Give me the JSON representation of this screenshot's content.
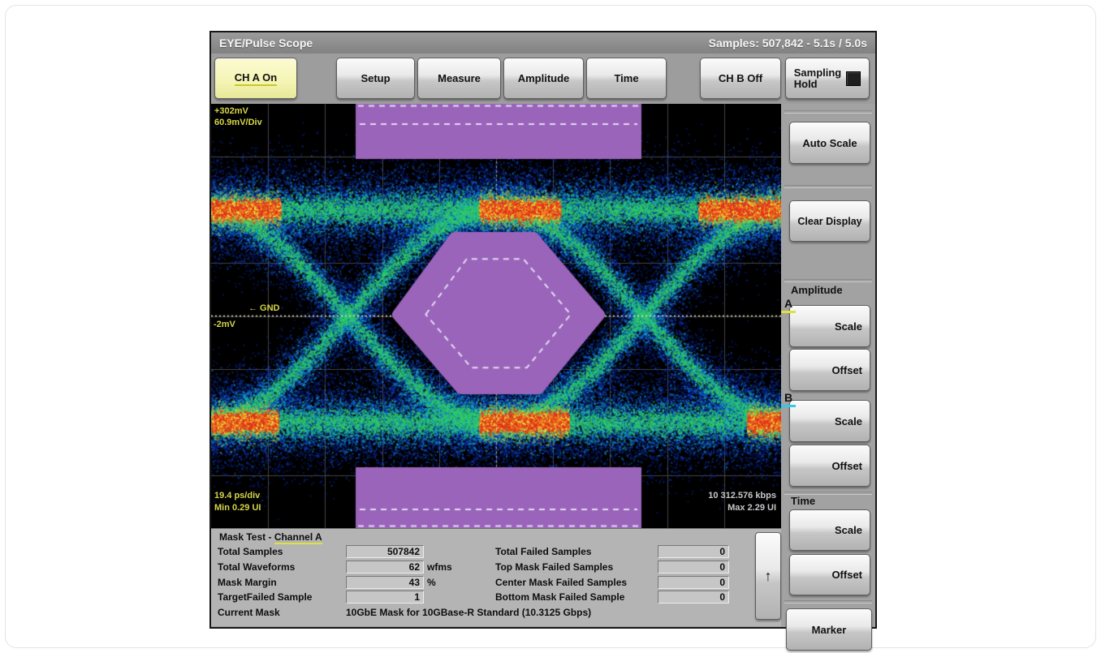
{
  "window": {
    "title": "EYE/Pulse Scope",
    "samples_readout": "Samples: 507,842 - 5.1s / 5.0s"
  },
  "toolbar": {
    "ch_a": "CH A On",
    "setup": "Setup",
    "measure": "Measure",
    "amplitude": "Amplitude",
    "time": "Time",
    "ch_b": "CH B Off",
    "sampling_line1": "Sampling",
    "sampling_line2": "Hold"
  },
  "display": {
    "top_left_line1": "+302mV",
    "top_left_line2": "60.9mV/Div",
    "gnd_label": "← GND",
    "offset_label": "-2mV",
    "bottom_left_line1": "19.4 ps/div",
    "bottom_left_line2": "Min 0.29 UI",
    "bottom_right_line1": "10 312.576 kbps",
    "bottom_right_line2": "Max 2.29 UI"
  },
  "sidebar": {
    "auto_scale": "Auto Scale",
    "clear_display": "Clear Display",
    "amplitude_section": "Amplitude",
    "time_section": "Time",
    "a_label": "A",
    "b_label": "B",
    "a_scale": "Scale",
    "a_offset": "Offset",
    "b_scale": "Scale",
    "b_offset": "Offset",
    "t_scale": "Scale",
    "t_offset": "Offset",
    "marker": "Marker"
  },
  "mask_test": {
    "header_prefix": "Mask Test - ",
    "header_channel": "Channel A",
    "rows_left": [
      {
        "label": "Total Samples",
        "value": "507842",
        "unit": ""
      },
      {
        "label": "Total Waveforms",
        "value": "62",
        "unit": "wfms"
      },
      {
        "label": "Mask Margin",
        "value": "43",
        "unit": "%"
      },
      {
        "label": "TargetFailed Sample",
        "value": "1",
        "unit": ""
      }
    ],
    "rows_right": [
      {
        "label": "Total Failed Samples",
        "value": "0"
      },
      {
        "label": "Top Mask Failed Samples",
        "value": "0"
      },
      {
        "label": "Center Mask Failed Samples",
        "value": "0"
      },
      {
        "label": "Bottom Mask Failed Sample",
        "value": "0"
      }
    ],
    "current_mask_label": "Current Mask",
    "current_mask_value": "10GbE Mask for 10GBase-R Standard  (10.3125 Gbps)",
    "scroll_up_icon": "↑"
  },
  "colors": {
    "mask_purple": "#9a64ba",
    "mask_dash": "#e4dbf2",
    "grid": "#464646",
    "gnd_dotted": "#e8e4b8",
    "label_yellow": "#d6d648",
    "channel_a_accent": "#e0e040",
    "channel_b_accent": "#35c8e8",
    "active_button": "#f4f4b4"
  },
  "chart_data": {
    "type": "heatmap",
    "title": "Eye diagram density plot with 10GbE mask test, Channel A",
    "x_axis": {
      "scale": "19.4 ps/div",
      "min_ui": 0.29,
      "max_ui": 2.29,
      "divisions": 10
    },
    "y_axis": {
      "scale": "60.9mV/Div",
      "top_value": "+302mV",
      "gnd_offset": "-2mV",
      "divisions": 8
    },
    "bit_rate": "10 312.576 kbps",
    "mask_margin_pct": 43,
    "grid": [
      10,
      8
    ],
    "eye": {
      "gnd": 0.499,
      "rail_top": 0.2486,
      "rail_bottom": 0.7495,
      "crossings": [
        0.2393,
        0.7578,
        -0.2792,
        1.2764
      ],
      "half_span": 0.2593,
      "layers": [
        {
          "sigma": 34,
          "color": "rgba(10,35,150,0.55)",
          "n_rail": 9000,
          "n_trans": 3800,
          "size": 2
        },
        {
          "sigma": 22,
          "color": "rgba(18,90,215,0.50)",
          "n_rail": 8000,
          "n_trans": 3400,
          "size": 2
        },
        {
          "sigma": 14,
          "color": "rgba(22,168,205,0.55)",
          "n_rail": 7000,
          "n_trans": 3000,
          "size": 2
        },
        {
          "sigma": 8.5,
          "color": "rgba(50,205,100,0.60)",
          "n_rail": 6000,
          "n_trans": 2600,
          "size": 2
        }
      ],
      "hotspots": {
        "top": [
          [
            0.0,
            0.121
          ],
          [
            0.47,
            0.612
          ],
          [
            0.855,
            1.0
          ]
        ],
        "bottom": [
          [
            0.0,
            0.117
          ],
          [
            0.47,
            0.627
          ],
          [
            0.94,
            1.0
          ]
        ]
      },
      "hot_colors": [
        "#e0331c",
        "#ef7c1d",
        "#ead83a"
      ],
      "halo_color": "rgba(167,207,58,0.5)"
    },
    "masks": {
      "color": "#9a64ba",
      "top_rect": {
        "x0": 0.2536,
        "x1": 0.755,
        "y0": 0.0,
        "y1": 0.13,
        "margin_y": 0.0478
      },
      "bottom_rect": {
        "x0": 0.2536,
        "x1": 0.755,
        "y0": 0.8566,
        "y1": 1.0,
        "margin_y": 0.956
      },
      "hexagon": [
        [
          0.3276,
          0.4971
        ],
        [
          0.4274,
          0.3155
        ],
        [
          0.5655,
          0.3155
        ],
        [
          0.6809,
          0.4971
        ],
        [
          0.5741,
          0.6712
        ],
        [
          0.4387,
          0.6712
        ]
      ],
      "margin_scale": 0.72
    }
  }
}
